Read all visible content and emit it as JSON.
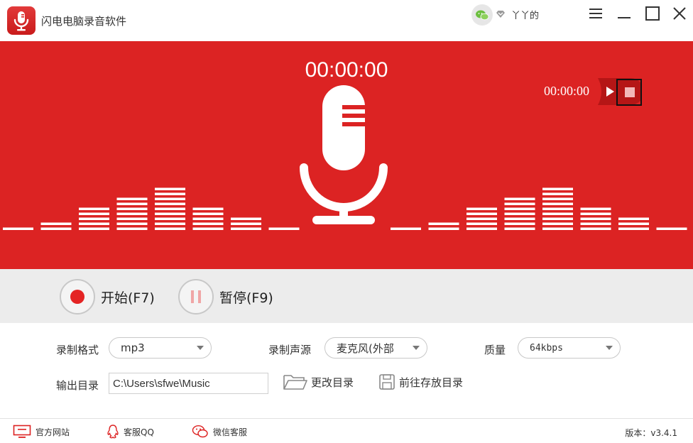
{
  "app": {
    "title": "闪电电脑录音软件",
    "user_name": "丫丫的"
  },
  "colors": {
    "brand_red": "#dc2323",
    "record_red": "#e42424",
    "pause_pink": "#f0a6a6"
  },
  "visualizer": {
    "main_timer": "00:00:00",
    "playback_timer": "00:00:00",
    "left_bar_levels": [
      1,
      2,
      5,
      7,
      9,
      5,
      3,
      1
    ],
    "right_bar_levels": [
      1,
      2,
      5,
      7,
      9,
      5,
      3,
      1
    ]
  },
  "controls": {
    "start_label": "开始(F7)",
    "pause_label": "暂停(F9)"
  },
  "settings": {
    "format_label": "录制格式",
    "format_value": "mp3",
    "source_label": "录制声源",
    "source_value": "麦克风(外部",
    "quality_label": "质量",
    "quality_value": "64kbps",
    "output_label": "输出目录",
    "output_value": "C:\\Users\\sfwe\\Music",
    "change_dir_label": "更改目录",
    "open_dir_label": "前往存放目录"
  },
  "footer": {
    "website_label": "官方网站",
    "qq_label": "客服QQ",
    "wechat_label": "微信客服",
    "version": "版本：v3.4.1"
  }
}
